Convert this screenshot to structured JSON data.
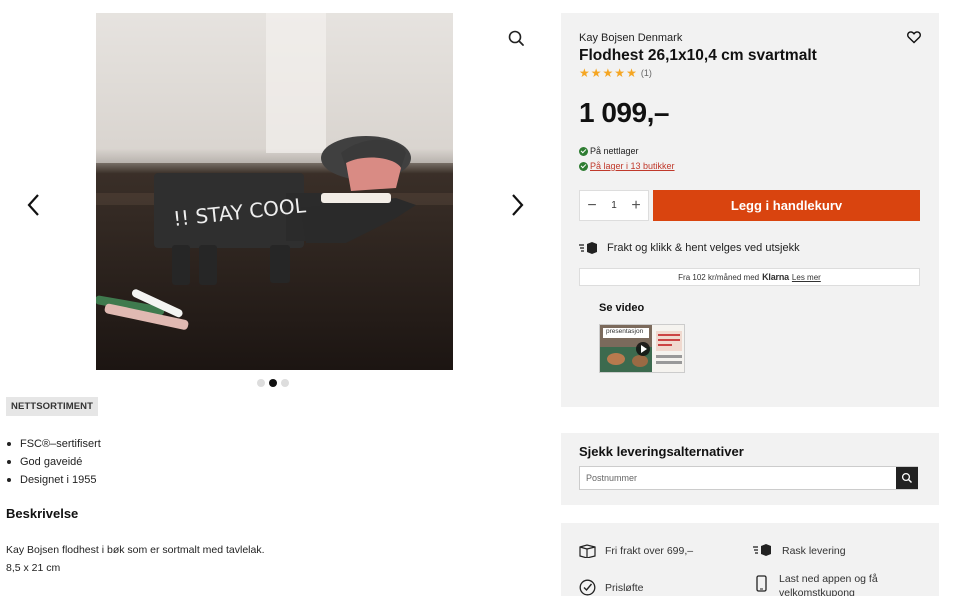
{
  "gallery": {
    "image_text": "!! STAY COOL",
    "dots": 3,
    "active_dot": 2
  },
  "badge": "NETTSORTIMENT",
  "features": [
    "FSC®–sertifisert",
    "God gaveidé",
    "Designet i 1955"
  ],
  "description": {
    "title": "Beskrivelse",
    "line1": "Kay Bojsen flodhest i bøk som er sortmalt med tavlelak.",
    "line2": "8,5 x 21 cm"
  },
  "product": {
    "brand": "Kay Bojsen Denmark",
    "title": "Flodhest 26,1x10,4 cm svartmalt",
    "rating_count": "(1)",
    "price": "1 099,–",
    "stock_online": "På nettlager",
    "stock_store": "På lager i 13 butikker",
    "quantity": "1",
    "cart_label": "Legg i handlekurv",
    "shipping_text": "Frakt og klikk & hent velges ved utsjekk",
    "klarna_prefix": "Fra 102 kr/måned med",
    "klarna_brand": "Klarna",
    "klarna_link": "Les mer",
    "video_title": "Se video",
    "video_label": "presentasjon"
  },
  "delivery": {
    "title": "Sjekk leveringsalternativer",
    "placeholder": "Postnummer"
  },
  "usp": {
    "free_shipping": "Fri frakt over 699,–",
    "fast_delivery": "Rask levering",
    "price_promise": "Prisløfte",
    "app_line1": "Last ned appen og få",
    "app_line2": "velkomstkupong"
  },
  "colors": {
    "accent": "#d9440f",
    "panel_bg": "#f2f2f2",
    "star": "#f5a623",
    "in_stock": "#2e7d32",
    "link": "#c0392b"
  }
}
